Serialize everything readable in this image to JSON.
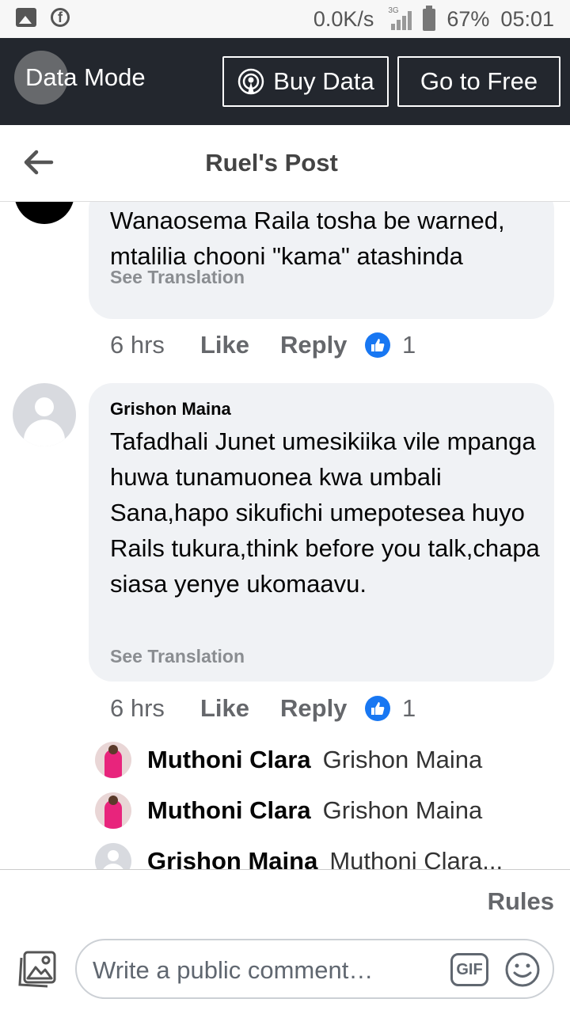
{
  "status_bar": {
    "speed": "0.0K/s",
    "network": "3G",
    "battery": "67%",
    "time": "05:01"
  },
  "data_bar": {
    "mode_label": "Data Mode",
    "buy_label": "Buy Data",
    "free_label": "Go to Free"
  },
  "header": {
    "title": "Ruel's Post"
  },
  "comments": [
    {
      "text": "Wanaosema Raila tosha be warned, mtalilia chooni \"kama\" atashinda",
      "see_translation": "See Translation",
      "time": "6 hrs",
      "like": "Like",
      "reply": "Reply",
      "reactions": "1"
    },
    {
      "author": "Grishon Maina",
      "text": "Tafadhali Junet umesikiika vile mpanga huwa tunamuonea kwa umbali Sana,hapo sikufichi umepotesea huyo Rails tukura,think before you talk,chapa siasa yenye ukomaavu.",
      "see_translation": "See Translation",
      "time": "6 hrs",
      "like": "Like",
      "reply": "Reply",
      "reactions": "1"
    }
  ],
  "replies": [
    {
      "name": "Muthoni Clara",
      "tag": "Grishon Maina"
    },
    {
      "name": "Muthoni Clara",
      "tag": "Grishon Maina"
    },
    {
      "name": "Grishon Maina",
      "tag": "Muthoni Clara..."
    }
  ],
  "footer": {
    "rules": "Rules",
    "placeholder": "Write a public comment…",
    "gif": "GIF"
  },
  "colors": {
    "accent": "#1877f2",
    "data_bar_bg": "#23272e",
    "bubble_bg": "#f0f2f5"
  }
}
